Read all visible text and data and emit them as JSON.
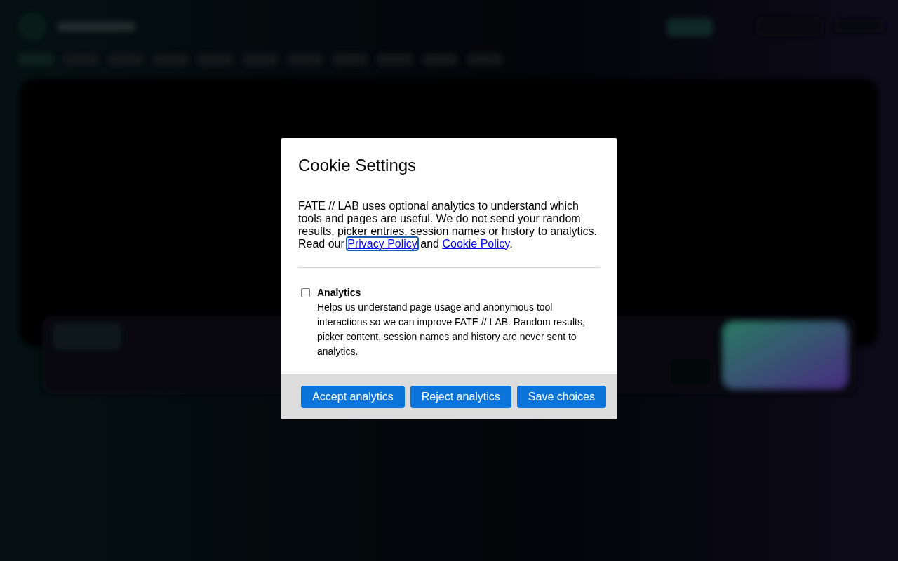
{
  "dialog": {
    "title": "Cookie Settings",
    "intro": [
      {
        "kind": "text",
        "text": "FATE // LAB uses optional analytics to understand which tools and pages are useful. We do not send your random results, picker entries, session names or history to analytics. Read our"
      },
      {
        "kind": "link",
        "text": "Privacy Policy",
        "focused": true
      },
      {
        "kind": "text",
        "text": "and"
      },
      {
        "kind": "link",
        "text": "Cookie Policy",
        "focused": false
      },
      {
        "kind": "text",
        "text": "."
      }
    ],
    "options": [
      {
        "label": "Analytics",
        "checked": false,
        "description": "Helps us understand page usage and anonymous tool interactions so we can improve FATE // LAB. Random results, picker content, session names and history are never sent to analytics."
      }
    ],
    "buttons": [
      "Accept analytics",
      "Reject analytics",
      "Save choices"
    ]
  }
}
